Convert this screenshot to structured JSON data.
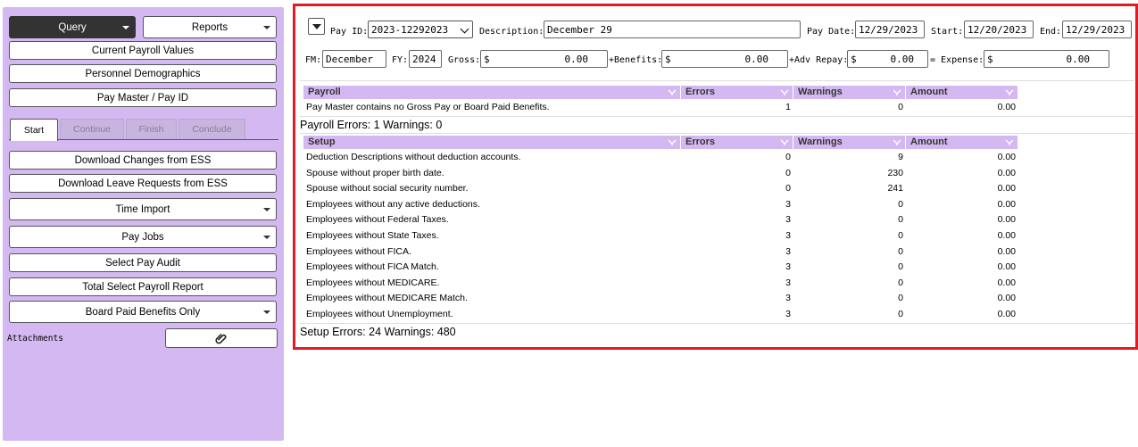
{
  "sidebar": {
    "query_label": "Query",
    "reports_label": "Reports",
    "current_payroll_label": "Current Payroll Values",
    "personnel_label": "Personnel Demographics",
    "paymaster_label": "Pay Master / Pay ID",
    "tabs": [
      "Start",
      "Continue",
      "Finish",
      "Conclude"
    ],
    "download_changes_label": "Download Changes from ESS",
    "download_leave_label": "Download Leave Requests from ESS",
    "time_import_label": "Time Import",
    "pay_jobs_label": "Pay Jobs",
    "select_audit_label": "Select Pay Audit",
    "total_report_label": "Total Select Payroll Report",
    "board_paid_label": "Board Paid Benefits Only",
    "attachments_label": "Attachments"
  },
  "header": {
    "pay_id_label": "Pay ID:",
    "pay_id_value": "2023-12292023",
    "description_label": "Description:",
    "description_value": "December 29",
    "pay_date_label": "Pay Date:",
    "pay_date_value": "12/29/2023",
    "start_label": "Start:",
    "start_value": "12/20/2023",
    "end_label": "End:",
    "end_value": "12/29/2023",
    "fm_label": "FM:",
    "fm_value": "December",
    "fy_label": "FY:",
    "fy_value": "2024",
    "gross_label": "Gross:",
    "gross_value": "0.00",
    "benefits_label": "+Benefits:",
    "benefits_value": "0.00",
    "adv_repay_label": "+Adv Repay:",
    "adv_repay_value": "0.00",
    "expense_label": "= Expense:",
    "expense_value": "0.00",
    "currency": "$"
  },
  "payroll_table": {
    "columns": [
      "Payroll",
      "Errors",
      "Warnings",
      "Amount"
    ],
    "rows": [
      [
        "Pay Master contains no Gross Pay or Board Paid Benefits.",
        "1",
        "0",
        "0.00"
      ]
    ],
    "summary": "Payroll Errors: 1 Warnings: 0"
  },
  "setup_table": {
    "columns": [
      "Setup",
      "Errors",
      "Warnings",
      "Amount"
    ],
    "rows": [
      [
        "Deduction Descriptions without deduction accounts.",
        "0",
        "9",
        "0.00"
      ],
      [
        "Spouse without proper birth date.",
        "0",
        "230",
        "0.00"
      ],
      [
        "Spouse without social security number.",
        "0",
        "241",
        "0.00"
      ],
      [
        "Employees without any active deductions.",
        "3",
        "0",
        "0.00"
      ],
      [
        "Employees without Federal Taxes.",
        "3",
        "0",
        "0.00"
      ],
      [
        "Employees without State Taxes.",
        "3",
        "0",
        "0.00"
      ],
      [
        "Employees without FICA.",
        "3",
        "0",
        "0.00"
      ],
      [
        "Employees without FICA Match.",
        "3",
        "0",
        "0.00"
      ],
      [
        "Employees without MEDICARE.",
        "3",
        "0",
        "0.00"
      ],
      [
        "Employees without MEDICARE Match.",
        "3",
        "0",
        "0.00"
      ],
      [
        "Employees without Unemployment.",
        "3",
        "0",
        "0.00"
      ]
    ],
    "summary": "Setup Errors: 24 Warnings: 480"
  },
  "colors": {
    "accent": "#d4b8f2",
    "highlight_border": "#e01b24",
    "dark_button": "#333333"
  }
}
